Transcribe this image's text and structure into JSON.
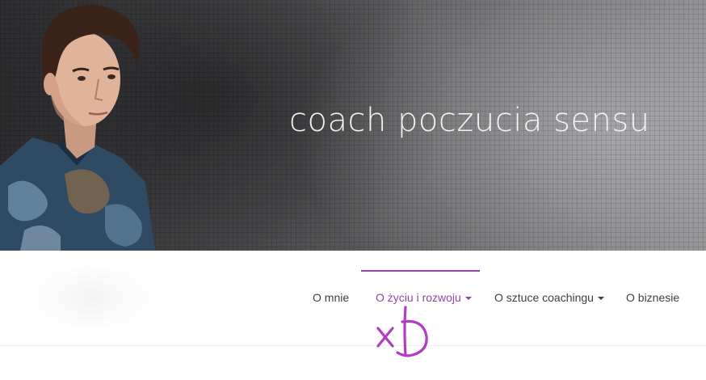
{
  "header": {
    "tagline": "coach poczucia sensu",
    "colors": {
      "banner_dark": "#2e2e30",
      "banner_light": "#8a8a8c",
      "tagline": "#f1f1f1"
    }
  },
  "nav": {
    "accent_color": "#8e44ad",
    "items": [
      {
        "label": "O mnie",
        "has_dropdown": false,
        "active": false
      },
      {
        "label": "O życiu i rozwoju",
        "has_dropdown": true,
        "active": true
      },
      {
        "label": "O sztuce coachingu",
        "has_dropdown": true,
        "active": false
      },
      {
        "label": "O biznesie",
        "has_dropdown": false,
        "active": false
      }
    ]
  },
  "annotation": {
    "doodle_text": "xD",
    "color": "#b23cc4"
  }
}
